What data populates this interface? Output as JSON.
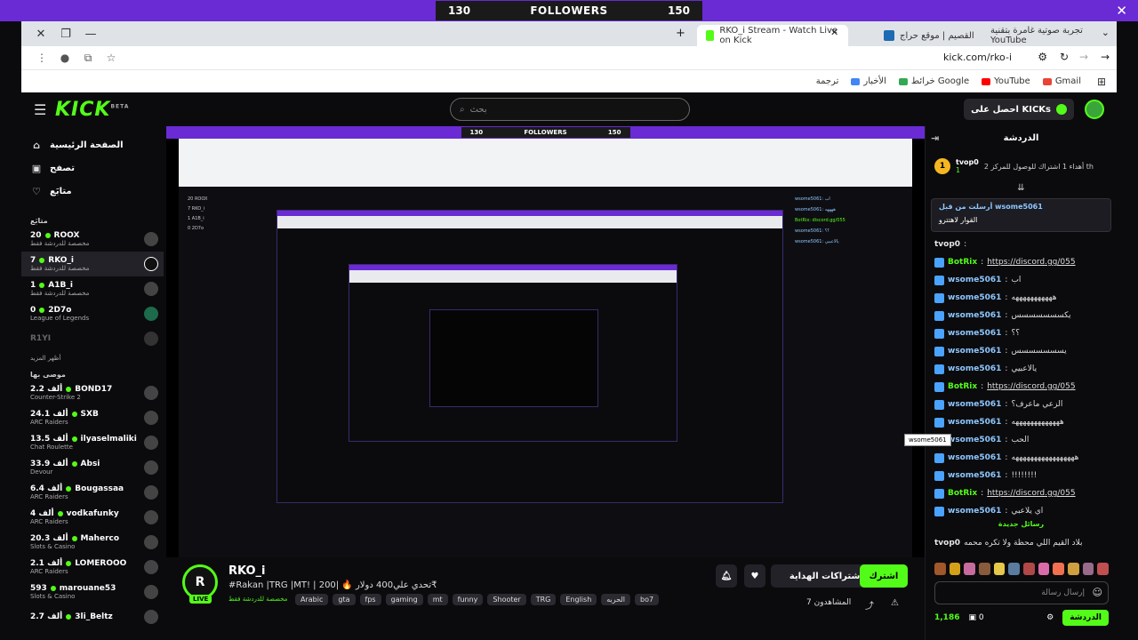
{
  "overlay": {
    "left_count": "130",
    "center_label": "FOLLOWERS",
    "right_count": "150"
  },
  "browser": {
    "tabs": [
      {
        "label": "تجربة صوتية غامرة بتقنية YouTube",
        "icon": "youtube-icon"
      },
      {
        "label": "القصيم | موقع حراج",
        "icon": "haraj-icon"
      },
      {
        "label": "RKO_i Stream - Watch Live on Kick",
        "icon": "kick-icon"
      }
    ],
    "url": "kick.com/rko-i",
    "bookmarks": [
      {
        "label": "Gmail",
        "color": "#ea4335"
      },
      {
        "label": "YouTube",
        "color": "#ff0000"
      },
      {
        "label": "خرائط Google",
        "color": "#34a853"
      },
      {
        "label": "الأخبار",
        "color": "#4285f4"
      },
      {
        "label": "ترجمة",
        "color": "#4285f4"
      }
    ]
  },
  "header": {
    "logo": "KICK",
    "logo_sup": "BETA",
    "search_placeholder": "بحث",
    "get_kicks": "احصل على KICKs"
  },
  "sidebar": {
    "nav": [
      {
        "label": "الصفحة الرئيسية",
        "icon": "home-icon"
      },
      {
        "label": "تصفح",
        "icon": "browse-icon"
      },
      {
        "label": "متابَع",
        "icon": "heart-icon"
      }
    ],
    "following_title": "متابَع",
    "following": [
      {
        "viewers": "20",
        "name": "ROOX",
        "sub": "مخصصة للدردشة فقط",
        "active": false
      },
      {
        "viewers": "7",
        "name": "RKO_i",
        "sub": "مخصصة للدردشة فقط",
        "active": true
      },
      {
        "viewers": "1",
        "name": "A1B_i",
        "sub": "مخصصة للدردشة فقط",
        "active": false
      },
      {
        "viewers": "0",
        "name": "2D7o",
        "sub": "League of Legends",
        "active": false
      },
      {
        "viewers": "",
        "name": "R1YI",
        "sub": "",
        "active": false
      }
    ],
    "show_more": "أظهر المزيد",
    "recommended_title": "موصى بها",
    "recommended": [
      {
        "viewers": "2.2 ألف",
        "name": "BOND17",
        "sub": "Counter-Strike 2"
      },
      {
        "viewers": "24.1 ألف",
        "name": "SXB",
        "sub": "ARC Raiders"
      },
      {
        "viewers": "13.5 ألف",
        "name": "ilyaselmaliki",
        "sub": "Chat Roulette"
      },
      {
        "viewers": "33.9 ألف",
        "name": "Absi",
        "sub": "Devour"
      },
      {
        "viewers": "6.4 ألف",
        "name": "Bougassaa",
        "sub": "ARC Raiders"
      },
      {
        "viewers": "4 ألف",
        "name": "vodkafunky",
        "sub": "ARC Raiders"
      },
      {
        "viewers": "20.3 ألف",
        "name": "Maherco",
        "sub": "Slots & Casino"
      },
      {
        "viewers": "2.1 ألف",
        "name": "LOMEROOO",
        "sub": "ARC Raiders"
      },
      {
        "viewers": "593",
        "name": "marouane53",
        "sub": "Slots & Casino"
      },
      {
        "viewers": "2.7 ألف",
        "name": "3li_Beltz",
        "sub": ""
      }
    ]
  },
  "player": {
    "inner_left": "130",
    "inner_center": "FOLLOWERS",
    "inner_right": "150"
  },
  "stream": {
    "avatar_text": "R",
    "live": "LIVE",
    "name": "RKO_i",
    "title": "#Rakan |TRG |MT! | تحدي علي400 دولار 🔥 |200₹",
    "category": "مخصصة للدردشة فقط",
    "tags": [
      "Arabic",
      "gta",
      "fps",
      "gaming",
      "mt",
      "funny",
      "Shooter",
      "TRG",
      "English",
      "الحربه",
      "bo7"
    ],
    "subscribe": "الاشتراكات الهداية",
    "follow": "اشترك",
    "viewers": "المشاهدون 7",
    "bell_icon": "bell-icon",
    "heart_icon": "heart-icon"
  },
  "chat": {
    "title": "الدردشة",
    "gift": {
      "coin": "1",
      "user": "tvop0",
      "count": "1",
      "text": "أهداء 1 اشتراك للوصول للمركز 2 th"
    },
    "pinned": {
      "by": "أرسلت من قبل wsome5061",
      "text": "القوار لاهتترو"
    },
    "messages": [
      {
        "user": "tvop0",
        "text": "",
        "link": "",
        "color": "#e6e6e6",
        "badge": false
      },
      {
        "user": "BotRix",
        "text": "",
        "link": "https://discord.gg/055",
        "color": "#53fc18",
        "badge": true
      },
      {
        "user": "wsome5061",
        "text": "اب",
        "link": "",
        "color": "#8ec7ff",
        "badge": true
      },
      {
        "user": "wsome5061",
        "text": "هههههههههههه",
        "link": "",
        "color": "#8ec7ff",
        "badge": true
      },
      {
        "user": "wsome5061",
        "text": "يكسسسسسسس",
        "link": "",
        "color": "#8ec7ff",
        "badge": true
      },
      {
        "user": "wsome5061",
        "text": "؟؟",
        "link": "",
        "color": "#8ec7ff",
        "badge": true
      },
      {
        "user": "wsome5061",
        "text": "يسسسسسسس",
        "link": "",
        "color": "#8ec7ff",
        "badge": true
      },
      {
        "user": "wsome5061",
        "text": "يالاعبيي",
        "link": "",
        "color": "#8ec7ff",
        "badge": true
      },
      {
        "user": "BotRix",
        "text": "",
        "link": "https://discord.gg/055",
        "color": "#53fc18",
        "badge": true
      },
      {
        "user": "wsome5061",
        "text": "الزعي ماعرف؟",
        "link": "",
        "color": "#8ec7ff",
        "badge": true
      },
      {
        "user": "wsome5061",
        "text": "هههههههههههههه",
        "link": "",
        "color": "#8ec7ff",
        "badge": true
      },
      {
        "user": "wsome5061",
        "text": "الحب",
        "link": "",
        "color": "#8ec7ff",
        "badge": true
      },
      {
        "user": "wsome5061",
        "text": "هههههههههههههههههه",
        "link": "",
        "color": "#8ec7ff",
        "badge": true
      },
      {
        "user": "wsome5061",
        "text": "!!!!!!!!",
        "link": "",
        "color": "#8ec7ff",
        "badge": true
      },
      {
        "user": "BotRix",
        "text": "",
        "link": "https://discord.gg/055",
        "color": "#53fc18",
        "badge": true
      },
      {
        "user": "wsome5061",
        "text": "اي يلاعبي",
        "link": "",
        "color": "#8ec7ff",
        "badge": true
      }
    ],
    "new_messages": "رسائل جديدة",
    "last": {
      "user": "tvop0",
      "text": "بلاد القيم اللي محظة ولا تكره محمه"
    },
    "tooltip": "wsome5061",
    "input_placeholder": "إرسال رسالة",
    "kicks": "1,186",
    "zero": "0",
    "send": "الدردشة"
  }
}
